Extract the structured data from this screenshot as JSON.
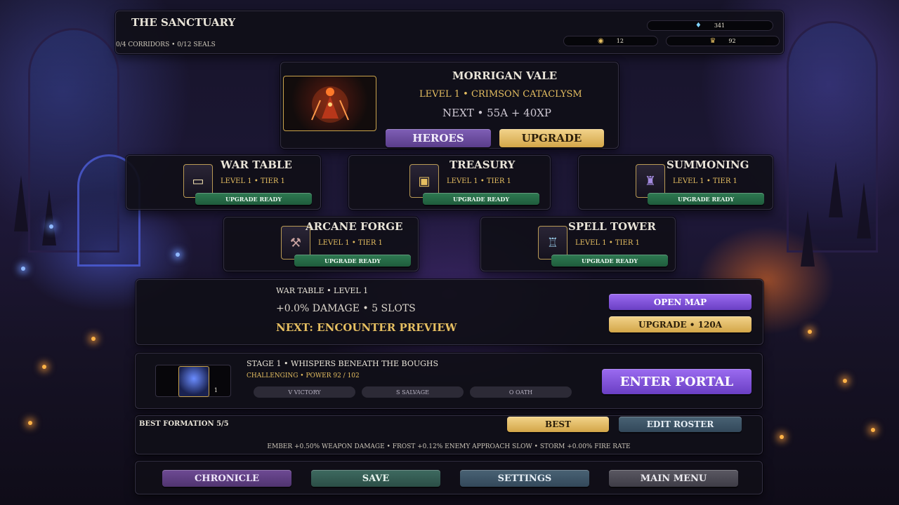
{
  "header": {
    "title": "THE SANCTUARY",
    "progress": "0/4 CORRIDORS • 0/12 SEALS",
    "resources": [
      {
        "icon": "crystal-icon",
        "value": "341"
      },
      {
        "icon": "gem-bag-icon",
        "value": "12"
      },
      {
        "icon": "trophy-icon",
        "value": "92"
      }
    ]
  },
  "hero": {
    "name": "MORRIGAN VALE",
    "level": "LEVEL 1 • CRIMSON CATACLYSM",
    "next": "NEXT • 55A + 40XP",
    "heroes_label": "HEROES",
    "upgrade_label": "UPGRADE"
  },
  "buildings": [
    {
      "name": "WAR TABLE",
      "level": "LEVEL 1 • TIER 1",
      "status": "UPGRADE READY",
      "icon": "scroll-icon"
    },
    {
      "name": "TREASURY",
      "level": "LEVEL 1 • TIER 1",
      "status": "UPGRADE READY",
      "icon": "chest-icon"
    },
    {
      "name": "SUMMONING",
      "level": "LEVEL 1 • TIER 1",
      "status": "UPGRADE READY",
      "icon": "circle-icon"
    },
    {
      "name": "ARCANE FORGE",
      "level": "LEVEL 1 • TIER 1",
      "status": "UPGRADE READY",
      "icon": "anvil-icon"
    },
    {
      "name": "SPELL TOWER",
      "level": "LEVEL 1 • TIER 1",
      "status": "UPGRADE READY",
      "icon": "tower-icon"
    }
  ],
  "info": {
    "title": "WAR TABLE • LEVEL 1",
    "stats": "+0.0% DAMAGE • 5 SLOTS",
    "next": "NEXT: ENCOUNTER PREVIEW",
    "open_map_label": "OPEN MAP",
    "upgrade_label": "UPGRADE • 120A"
  },
  "stage": {
    "title": "STAGE 1 • WHISPERS BENEATH THE BOUGHS",
    "difficulty": "CHALLENGING • POWER 92 / 102",
    "thumb_number": "1",
    "chips": [
      "V VICTORY",
      "S SALVAGE",
      "O OATH"
    ],
    "enter_label": "ENTER PORTAL"
  },
  "formation": {
    "title": "BEST FORMATION 5/5",
    "best_label": "BEST",
    "edit_label": "EDIT ROSTER",
    "bonuses": "EMBER +0.50% WEAPON DAMAGE • FROST +0.12% ENEMY APPROACH SLOW • STORM +0.00% FIRE RATE"
  },
  "nav": {
    "chronicle": "CHRONICLE",
    "save": "SAVE",
    "settings": "SETTINGS",
    "main_menu": "MAIN MENU"
  }
}
